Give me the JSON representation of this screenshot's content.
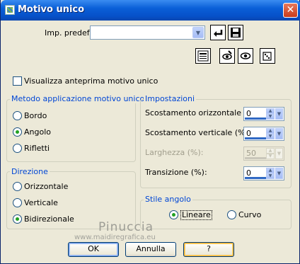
{
  "window": {
    "title": "Motivo unico",
    "close": "✕"
  },
  "preset": {
    "label": "Imp. predef.:",
    "value": "",
    "arrow": "▼"
  },
  "preview_checkbox": {
    "label": "Visualizza anteprima motivo unico",
    "checked": false
  },
  "metodo": {
    "legend": "Metodo applicazione motivo unico",
    "options": [
      {
        "label": "Bordo",
        "selected": false
      },
      {
        "label": "Angolo",
        "selected": true
      },
      {
        "label": "Rifletti",
        "selected": false
      }
    ]
  },
  "direzione": {
    "legend": "Direzione",
    "options": [
      {
        "label": "Orizzontale",
        "selected": false
      },
      {
        "label": "Verticale",
        "selected": false
      },
      {
        "label": "Bidirezionale",
        "selected": true
      }
    ]
  },
  "impostazioni": {
    "legend": "Impostazioni",
    "fields": [
      {
        "label": "Scostamento orizzontale (%):",
        "value": "0",
        "enabled": true
      },
      {
        "label": "Scostamento verticale (%):",
        "value": "0",
        "enabled": true
      },
      {
        "label": "Larghezza (%):",
        "value": "50",
        "enabled": false
      },
      {
        "label": "Transizione (%):",
        "value": "0",
        "enabled": true
      }
    ]
  },
  "stile": {
    "legend": "Stile angolo",
    "options": [
      {
        "label": "Lineare",
        "selected": true
      },
      {
        "label": "Curvo",
        "selected": false
      }
    ]
  },
  "buttons": {
    "ok": "OK",
    "cancel": "Annulla",
    "help": "?"
  },
  "watermark": {
    "name": "Pinuccia",
    "site": "www.maidiregrafica.eu"
  },
  "colors": {
    "legend": "#0046d5",
    "radio_dot": "#21a121",
    "title_bar": "#0a5fd8"
  }
}
